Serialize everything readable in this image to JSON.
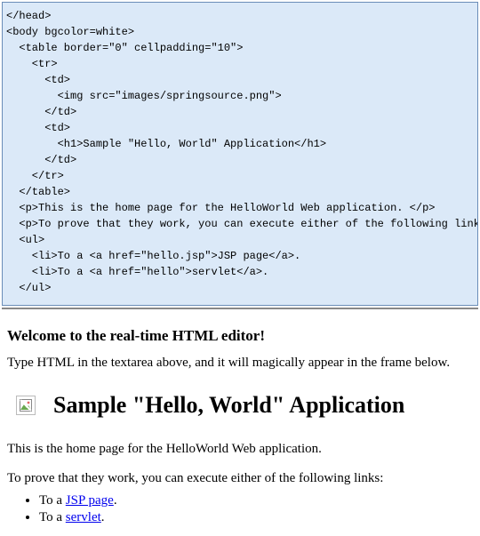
{
  "editor": {
    "lines": [
      "</head>",
      "<body bgcolor=white>",
      "",
      "  <table border=\"0\" cellpadding=\"10\">",
      "    <tr>",
      "      <td>",
      "        <img src=\"images/springsource.png\">",
      "      </td>",
      "      <td>",
      "        <h1>Sample \"Hello, World\" Application</h1>",
      "      </td>",
      "    </tr>",
      "  </table>",
      "",
      "  <p>This is the home page for the HelloWorld Web application. </p>",
      "  <p>To prove that they work, you can execute either of the following links:",
      "  <ul>",
      "    <li>To a <a href=\"hello.jsp\">JSP page</a>.",
      "    <li>To a <a href=\"hello\">servlet</a>.",
      "  </ul>",
      ""
    ]
  },
  "preview": {
    "welcome_heading": "Welcome to the real-time HTML editor!",
    "intro_text": "Type HTML in the textarea above, and it will magically appear in the frame below.",
    "sample_heading": "Sample \"Hello, World\" Application",
    "paragraph1": "This is the home page for the HelloWorld Web application.",
    "paragraph2": "To prove that they work, you can execute either of the following links:",
    "list": [
      {
        "prefix": "To a ",
        "link_text": "JSP page",
        "suffix": "."
      },
      {
        "prefix": "To a ",
        "link_text": "servlet",
        "suffix": "."
      }
    ]
  }
}
